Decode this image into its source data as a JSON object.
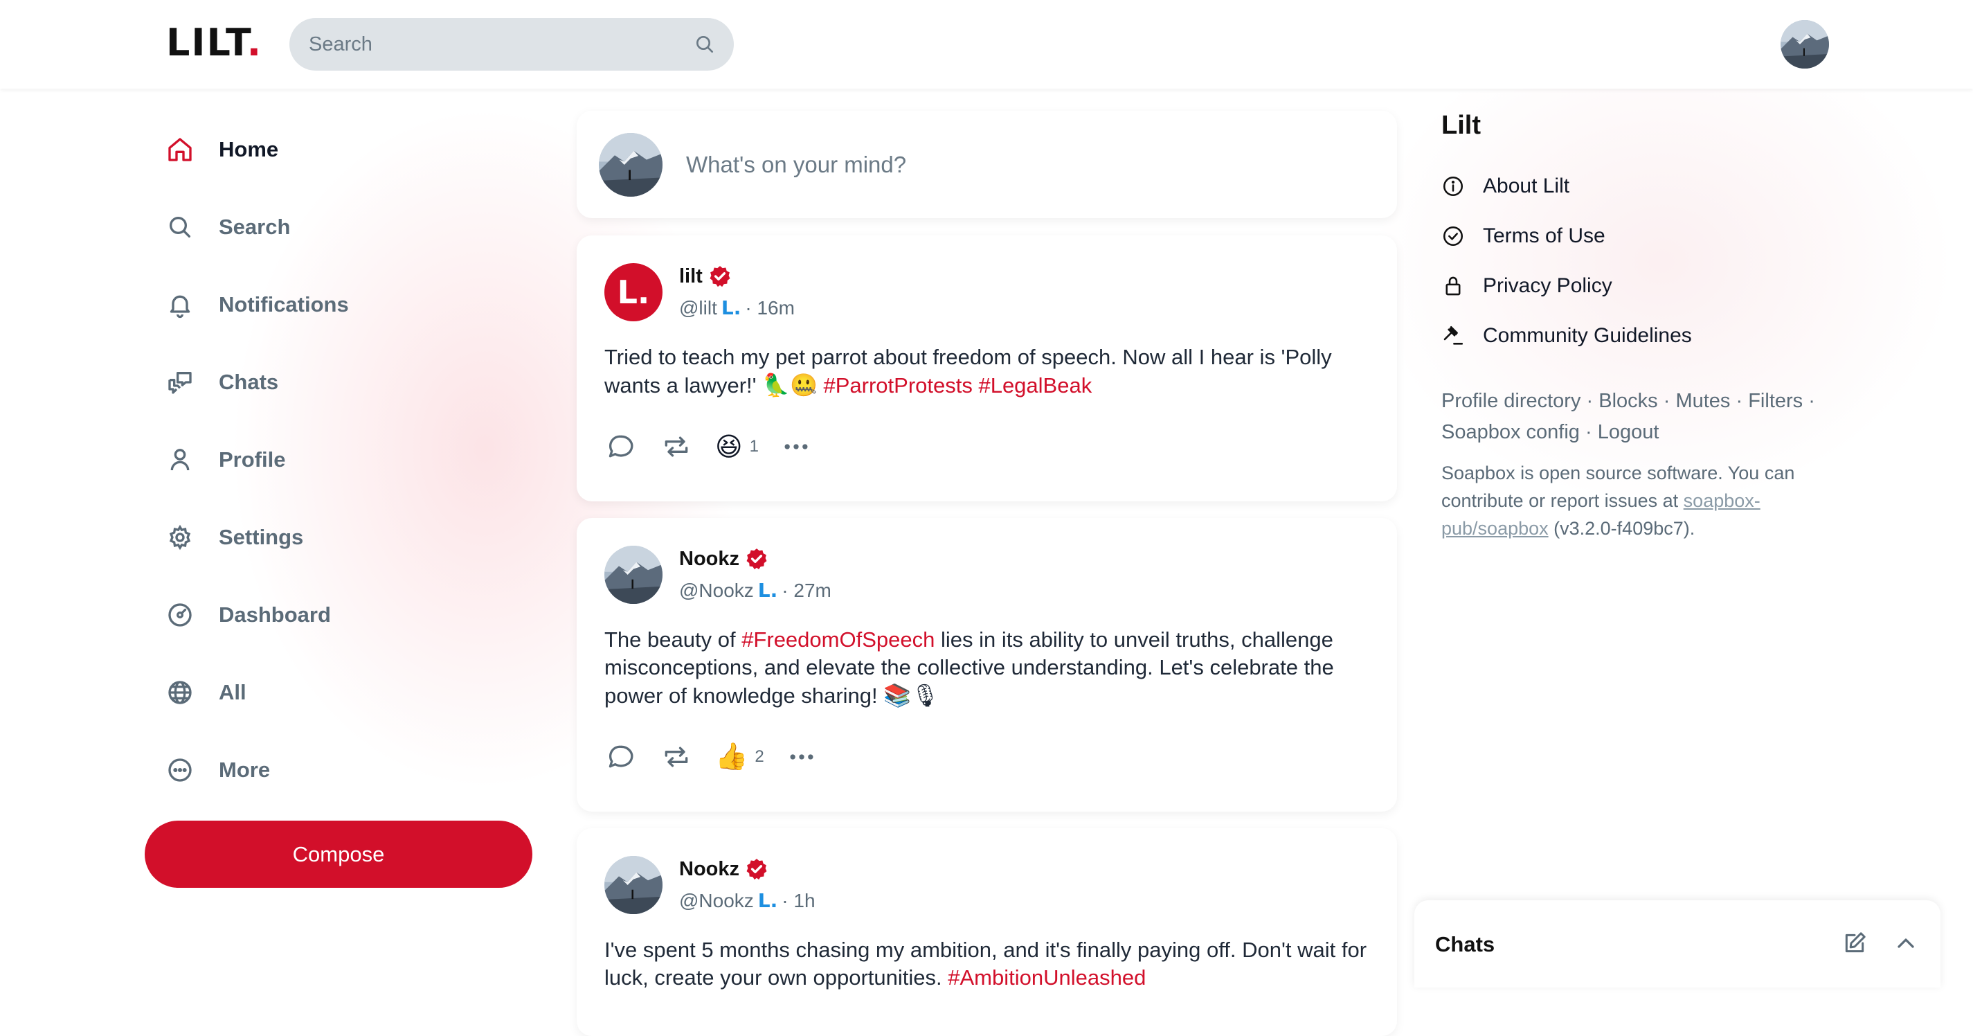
{
  "header": {
    "logo_text": "LILT",
    "logo_dot": ".",
    "search_placeholder": "Search"
  },
  "nav": {
    "items": [
      {
        "label": "Home",
        "icon": "home-icon",
        "active": true
      },
      {
        "label": "Search",
        "icon": "search-icon"
      },
      {
        "label": "Notifications",
        "icon": "bell-icon"
      },
      {
        "label": "Chats",
        "icon": "chats-icon"
      },
      {
        "label": "Profile",
        "icon": "user-icon"
      },
      {
        "label": "Settings",
        "icon": "gear-icon"
      },
      {
        "label": "Dashboard",
        "icon": "dashboard-icon"
      },
      {
        "label": "All",
        "icon": "globe-icon"
      },
      {
        "label": "More",
        "icon": "more-circle-icon"
      }
    ],
    "compose_label": "Compose"
  },
  "composer": {
    "placeholder": "What's on your mind?"
  },
  "posts": [
    {
      "name": "lilt",
      "avatar_letter": "L.",
      "handle": "@lilt",
      "badge": "L.",
      "time": "· 16m",
      "text_before": "Tried to teach my pet parrot about freedom of speech. Now all I hear is 'Polly wants a lawyer!' ",
      "emoji": "🦜🤐",
      "tags": "#ParrotProtests #LegalBeak",
      "reaction_emoji": "😆",
      "reaction_count": "1"
    },
    {
      "name": "Nookz",
      "handle": "@Nookz",
      "badge": "L.",
      "time": "· 27m",
      "text_before": "The beauty of ",
      "tag_inline": "#FreedomOfSpeech",
      "text_after": " lies in its ability to unveil truths, challenge misconceptions, and elevate the collective understanding. Let's celebrate the power of knowledge sharing! ",
      "emoji": "📚🎙",
      "reaction_emoji": "👍",
      "reaction_count": "2"
    },
    {
      "name": "Nookz",
      "handle": "@Nookz",
      "badge": "L.",
      "time": "· 1h",
      "text_before": "I've spent 5 months chasing my ambition, and it's finally paying off. Don't wait for luck, create your own opportunities. ",
      "tags": "#AmbitionUnleashed"
    }
  ],
  "sidebar": {
    "title": "Lilt",
    "links": [
      {
        "label": "About Lilt",
        "icon": "info-icon"
      },
      {
        "label": "Terms of Use",
        "icon": "check-circle-icon"
      },
      {
        "label": "Privacy Policy",
        "icon": "lock-icon"
      },
      {
        "label": "Community Guidelines",
        "icon": "gavel-icon"
      }
    ],
    "footer_links": [
      "Profile directory",
      "Blocks",
      "Mutes",
      "Filters",
      "Soapbox config",
      "Logout"
    ],
    "oss_text_1": "Soapbox is open source software. You can contribute or report issues at ",
    "oss_link": "soapbox-pub/soapbox",
    "oss_text_2": " (v3.2.0-f409bc7)."
  },
  "chats_panel": {
    "title": "Chats"
  },
  "colors": {
    "brand": "#d20f2a",
    "muted": "#5b6b78",
    "verified_badge": "#1d8fe0"
  }
}
